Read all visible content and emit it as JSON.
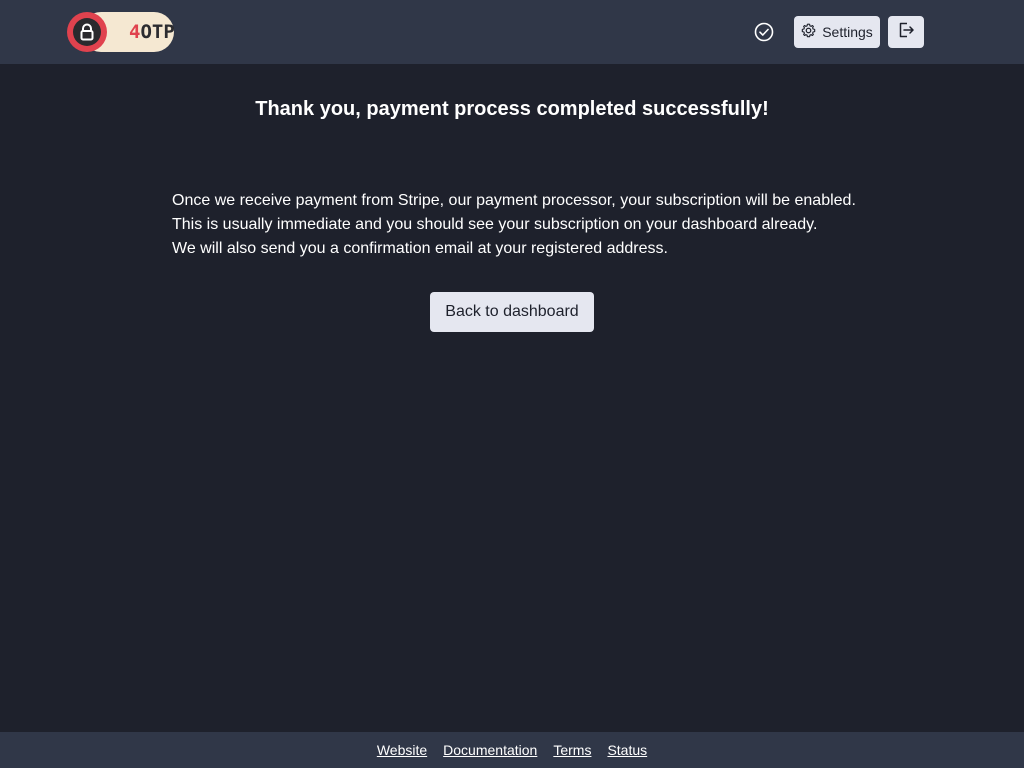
{
  "header": {
    "logo": {
      "prefix": "4",
      "suffix": "OTP"
    },
    "status_icon": "check-circle-icon",
    "settings_label": "Settings",
    "settings_icon": "gear-icon",
    "logout_icon": "logout-icon"
  },
  "main": {
    "title": "Thank you, payment process completed successfully!",
    "lines": [
      "Once we receive payment from Stripe, our payment processor, your subscription will be enabled.",
      "This is usually immediate and you should see your subscription on your dashboard already.",
      "We will also send you a confirmation email at your registered address."
    ],
    "button_label": "Back to dashboard"
  },
  "footer": {
    "links": [
      "Website",
      "Documentation",
      "Terms",
      "Status"
    ]
  },
  "colors": {
    "background": "#1e212c",
    "bar": "#303748",
    "button": "#e5e7f0",
    "brand_red": "#e0424e",
    "brand_cream": "#f5e8d2"
  }
}
